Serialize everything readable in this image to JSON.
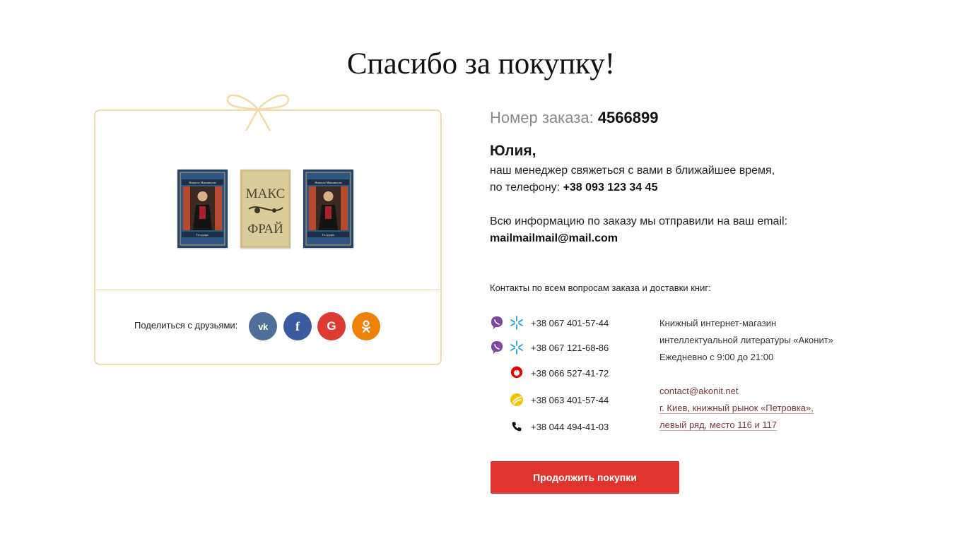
{
  "page": {
    "title": "Спасибо за покупку!"
  },
  "share": {
    "label": "Поделиться с друзьями:",
    "buttons": [
      {
        "icon": "vk-icon",
        "glyph": "vk",
        "color": "#4f6f9a"
      },
      {
        "icon": "facebook-icon",
        "glyph": "f",
        "color": "#3b5ba0"
      },
      {
        "icon": "google-icon",
        "glyph": "G",
        "color": "#dd3a31"
      },
      {
        "icon": "odnoklassniki-icon",
        "glyph": "ok",
        "color": "#ee8208"
      }
    ]
  },
  "books": [
    {
      "cover_top": "Никколо Макиавелли",
      "cover_bottom": "Государь"
    },
    {
      "cover_top": "МАКС",
      "cover_bottom": "ФРАЙ"
    },
    {
      "cover_top": "Никколо Макиавелли",
      "cover_bottom": "Государь"
    }
  ],
  "order": {
    "label": "Номер заказа:",
    "number": "4566899"
  },
  "customer": {
    "name": "Юлия,",
    "manager_text": "наш менеджер свяжеться с вами в ближайшее время,",
    "phone_label": "по телефону:",
    "phone": "+38 093 123 34 45",
    "email_text": "Всю информацию по заказу мы отправили на ваш email:",
    "email": "mailmailmail@mail.com"
  },
  "contacts": {
    "heading": "Контакты по всем вопросам заказа и доставки книг:",
    "phones": [
      {
        "number": "+38 067 401-57-44",
        "icons": [
          "viber-icon",
          "kyivstar-icon"
        ]
      },
      {
        "number": "+38 067 121-68-86",
        "icons": [
          "viber-icon",
          "kyivstar-icon"
        ]
      },
      {
        "number": "+38 066 527-41-72",
        "icons": [
          "vodafone-icon"
        ]
      },
      {
        "number": "+38 063 401-57-44",
        "icons": [
          "lifecell-icon"
        ]
      },
      {
        "number": "+38 044 494-41-03",
        "icons": [
          "landline-phone-icon"
        ]
      }
    ],
    "shop_lines": [
      "Книжный интернет-магазин",
      "интеллектуальной литературы «Аконит»",
      "Ежедневно с 9:00 до 21:00"
    ],
    "email": "contact@akonit.net",
    "address_lines": [
      "г. Киев, книжный рынок «Петровка»,",
      "левый ряд, место 116 и 117"
    ]
  },
  "actions": {
    "continue_label": "Продолжить покупки"
  },
  "colors": {
    "accent": "#e0352f",
    "gift_border": "#f3dca4",
    "link": "#7a3a3a"
  }
}
